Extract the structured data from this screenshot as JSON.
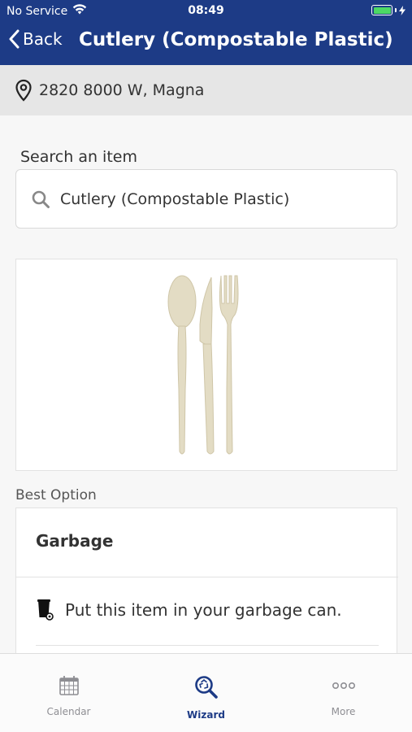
{
  "status_bar": {
    "carrier": "No Service",
    "time": "08:49",
    "battery_level": 1.0
  },
  "nav": {
    "back_label": "Back",
    "title": "Cutlery (Compostable Plastic)"
  },
  "location": {
    "address": "2820 8000 W, Magna",
    "icon": "map-pin-icon"
  },
  "search": {
    "label": "Search an item",
    "value": "Cutlery (Compostable Plastic)",
    "icon": "search-icon"
  },
  "item_image": {
    "icon": "cutlery-image"
  },
  "best_option": {
    "heading": "Best Option",
    "title": "Garbage",
    "instruction": "Put this item in your garbage can.",
    "icon": "garbage-can-icon"
  },
  "tabs": [
    {
      "label": "Calendar",
      "icon": "calendar-icon",
      "active": false
    },
    {
      "label": "Wizard",
      "icon": "wizard-search-icon",
      "active": true
    },
    {
      "label": "More",
      "icon": "more-dots-icon",
      "active": false
    }
  ],
  "colors": {
    "brand": "#1d3b86",
    "battery": "#4cd964",
    "tab_inactive": "#8e8e93"
  }
}
